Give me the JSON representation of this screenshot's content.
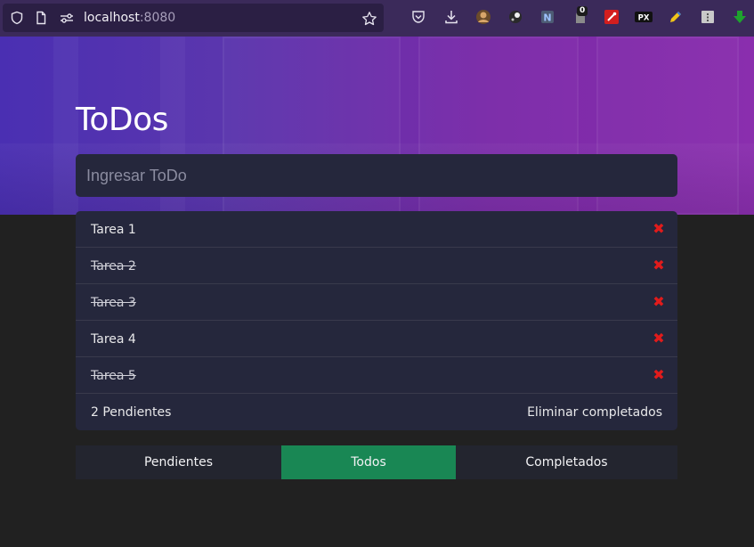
{
  "browser": {
    "url_host": "localhost",
    "url_port": ":8080",
    "notification_badge": "0",
    "px_extension_label": "PX",
    "colors": {
      "toolbar": "#3b2a5a",
      "urlbar": "#2b1f44"
    }
  },
  "app": {
    "title": "ToDos",
    "input_placeholder": "Ingresar ToDo",
    "todos": [
      {
        "label": "Tarea 1",
        "completed": false
      },
      {
        "label": "Tarea 2",
        "completed": true
      },
      {
        "label": "Tarea 3",
        "completed": true
      },
      {
        "label": "Tarea 4",
        "completed": false
      },
      {
        "label": "Tarea 5",
        "completed": true
      }
    ],
    "pending_count_label": "2 Pendientes",
    "clear_completed_label": "Eliminar completados",
    "filters": [
      {
        "label": "Pendientes",
        "active": false
      },
      {
        "label": "Todos",
        "active": true
      },
      {
        "label": "Completados",
        "active": false
      }
    ],
    "colors": {
      "card": "#25273c",
      "page_background": "#212121",
      "delete_icon": "#e21b1b",
      "active_filter": "#198754"
    }
  }
}
